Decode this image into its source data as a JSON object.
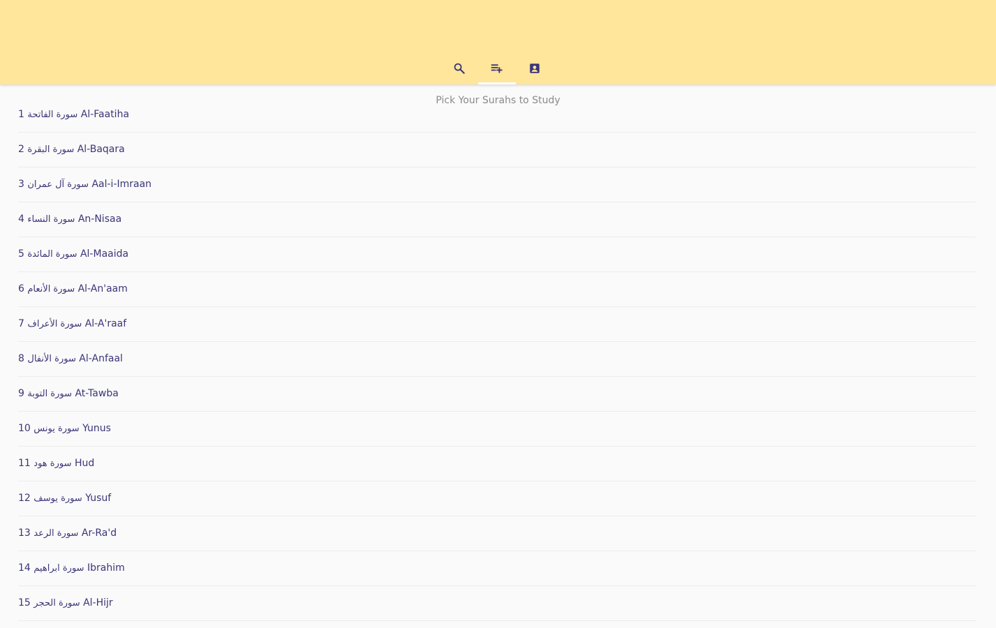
{
  "colors": {
    "appbar": "#ffe69a",
    "icon": "#3b3578",
    "text": "#3b3578",
    "subtitle": "#8a8a8a"
  },
  "tabs": [
    {
      "icon": "search-icon"
    },
    {
      "icon": "playlist-add-icon"
    },
    {
      "icon": "contact-icon"
    }
  ],
  "subtitle": "Pick Your Surahs to Study",
  "surahs": [
    {
      "number": "1",
      "arabic": "سورة الفاتحة",
      "name": "Al-Faatiha"
    },
    {
      "number": "2",
      "arabic": "سورة البقرة",
      "name": "Al-Baqara"
    },
    {
      "number": "3",
      "arabic": "سورة آل عمران",
      "name": "Aal-i-Imraan"
    },
    {
      "number": "4",
      "arabic": "سورة النساء",
      "name": "An-Nisaa"
    },
    {
      "number": "5",
      "arabic": "سورة المائدة",
      "name": "Al-Maaida"
    },
    {
      "number": "6",
      "arabic": "سورة الأنعام",
      "name": "Al-An'aam"
    },
    {
      "number": "7",
      "arabic": "سورة الأعراف",
      "name": "Al-A'raaf"
    },
    {
      "number": "8",
      "arabic": "سورة الأنفال",
      "name": "Al-Anfaal"
    },
    {
      "number": "9",
      "arabic": "سورة التوبة",
      "name": "At-Tawba"
    },
    {
      "number": "10",
      "arabic": "سورة يونس",
      "name": "Yunus"
    },
    {
      "number": "11",
      "arabic": "سورة هود",
      "name": "Hud"
    },
    {
      "number": "12",
      "arabic": "سورة يوسف",
      "name": "Yusuf"
    },
    {
      "number": "13",
      "arabic": "سورة الرعد",
      "name": "Ar-Ra'd"
    },
    {
      "number": "14",
      "arabic": "سورة ابراهيم",
      "name": "Ibrahim"
    },
    {
      "number": "15",
      "arabic": "سورة الحجر",
      "name": "Al-Hijr"
    }
  ]
}
